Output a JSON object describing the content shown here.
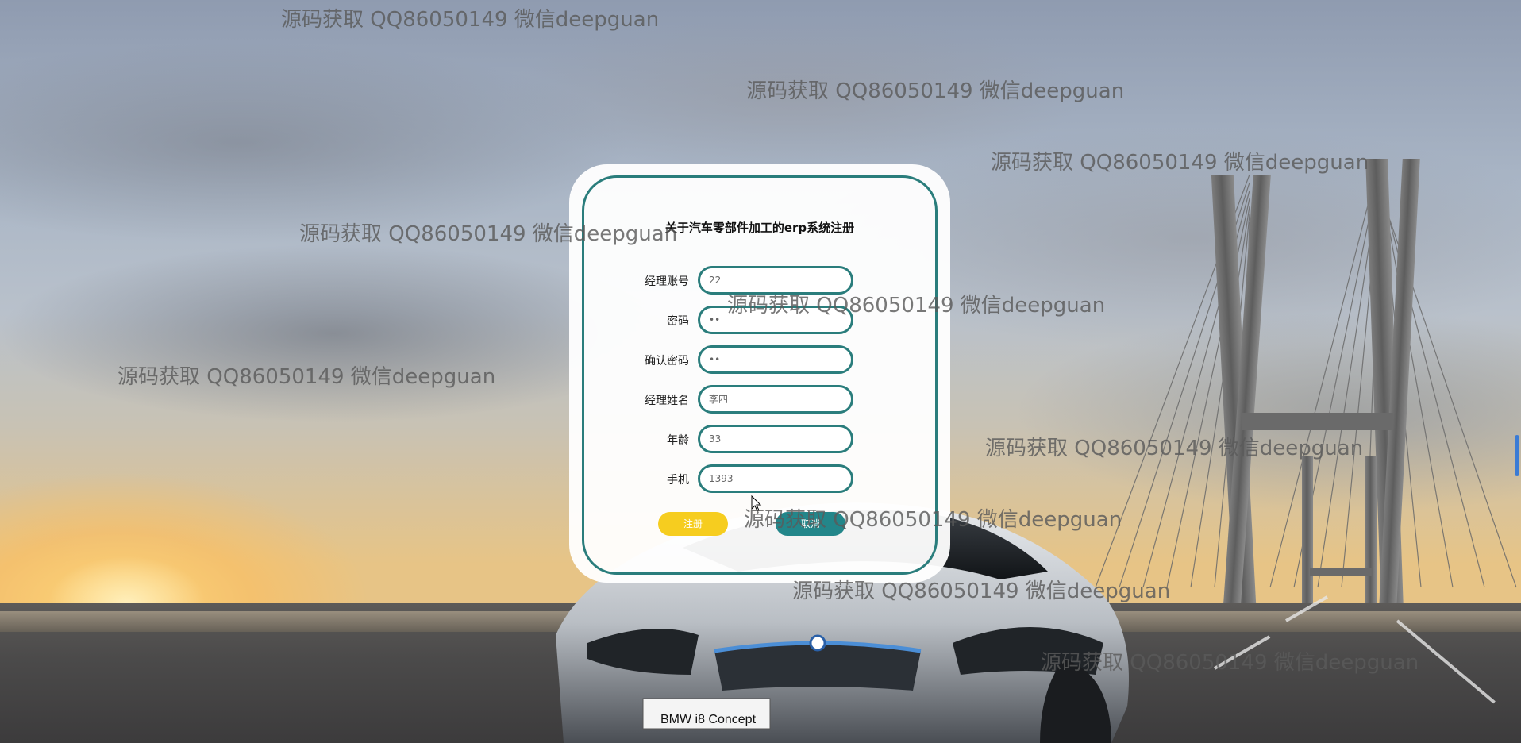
{
  "dialog": {
    "title": "关于汽车零部件加工的erp系统注册",
    "fields": [
      {
        "label": "经理账号",
        "value": "22"
      },
      {
        "label": "密码",
        "value": "••"
      },
      {
        "label": "确认密码",
        "value": "••"
      },
      {
        "label": "经理姓名",
        "value": "李四"
      },
      {
        "label": "年龄",
        "value": "33"
      },
      {
        "label": "手机",
        "value": "1393"
      }
    ],
    "register_label": "注册",
    "cancel_label": "取消"
  },
  "car_badge": "BMW i8 Concept",
  "watermark": "源码获取 QQ86050149 微信deepguan",
  "colors": {
    "accent": "#2a7d7c",
    "register": "#f6cd1f",
    "cancel": "#23868a"
  }
}
